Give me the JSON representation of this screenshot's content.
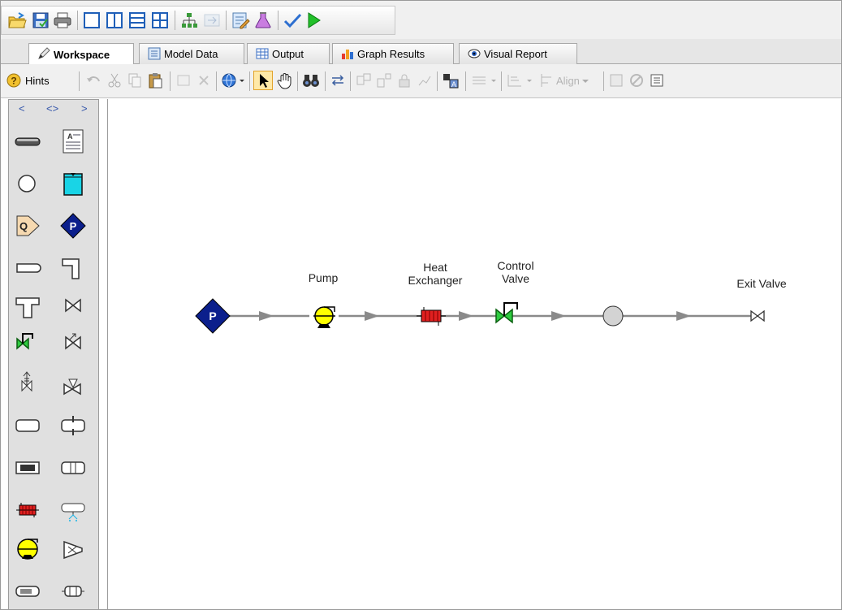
{
  "tabs": [
    {
      "label": "Workspace",
      "active": true
    },
    {
      "label": "Model Data"
    },
    {
      "label": "Output"
    },
    {
      "label": "Graph Results"
    },
    {
      "label": "Visual Report"
    }
  ],
  "workspace_toolbar": {
    "hints_label": "Hints",
    "align_label": "Align"
  },
  "palette": {
    "nav_prev": "<",
    "nav_toggle": "<>",
    "nav_next": ">",
    "items": [
      "pipe",
      "annotation",
      "branch",
      "reservoir",
      "assigned-flow",
      "assigned-pressure",
      "bend",
      "elbow",
      "tee",
      "valve",
      "control-valve",
      "check-valve",
      "relief-valve",
      "three-way-valve",
      "general-component",
      "orifice",
      "area-change",
      "screen",
      "heat-exchanger",
      "spray-discharge",
      "pump",
      "compressor",
      "dead-end",
      "volume-balance"
    ]
  },
  "canvas": {
    "node_pressure_letter": "P",
    "labels": {
      "pump": "Pump",
      "heat_exchanger_line1": "Heat",
      "heat_exchanger_line2": "Exchanger",
      "control_valve_line1": "Control",
      "control_valve_line2": "Valve",
      "exit_valve": "Exit Valve"
    }
  },
  "colors": {
    "assigned_pressure": "#0b1f8c",
    "pump": "#ffff00",
    "heat_exchanger": "#e02020",
    "control_valve": "#2ecc40",
    "reservoir": "#19d4e6",
    "pipe": "#8a8a8a"
  }
}
